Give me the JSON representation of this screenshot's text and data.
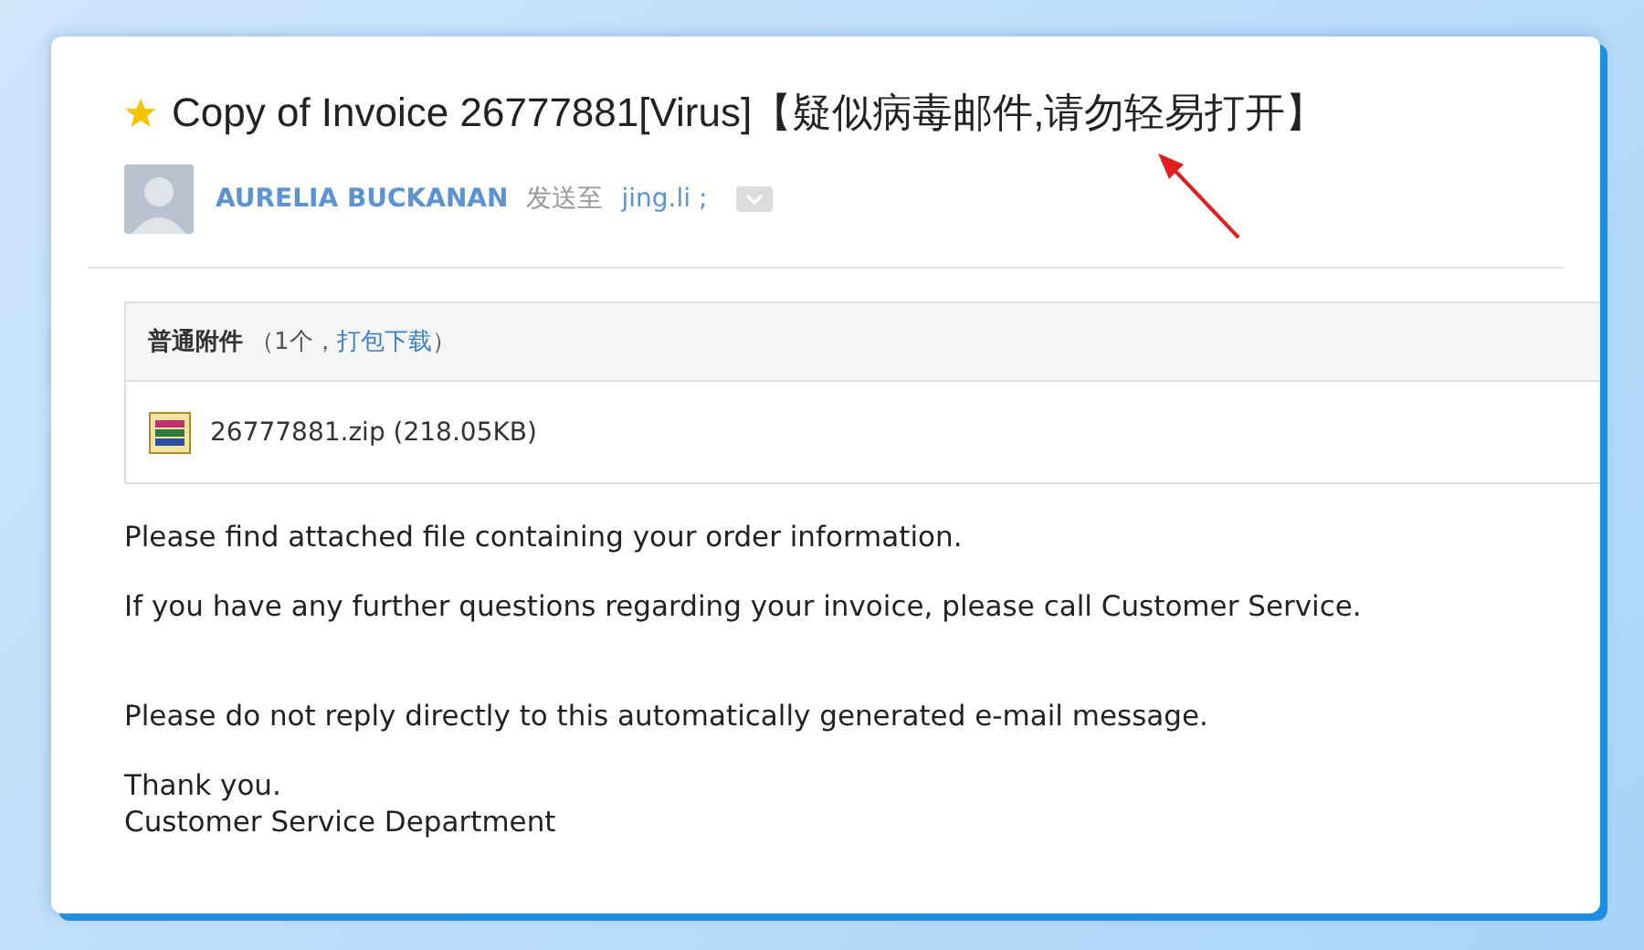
{
  "email": {
    "starred": true,
    "subject": "Copy of Invoice 26777881[Virus]【疑似病毒邮件,请勿轻易打开】",
    "sender": "AURELIA BUCKANAN",
    "sent_to_label": "发送至",
    "recipient": "jing.li ;",
    "attachments": {
      "title": "普通附件",
      "count_prefix": "（1个，",
      "download_all": "打包下载",
      "count_suffix": "）",
      "files": [
        {
          "name": "26777881.zip (218.05KB)"
        }
      ]
    },
    "body": [
      "Please find attached file containing your order information.",
      "If you have any further questions regarding your invoice, please call Customer Service."
    ],
    "notice": "Please do not reply directly to this automatically generated e-mail message.",
    "closing": [
      "Thank you.",
      "Customer Service Department"
    ]
  }
}
